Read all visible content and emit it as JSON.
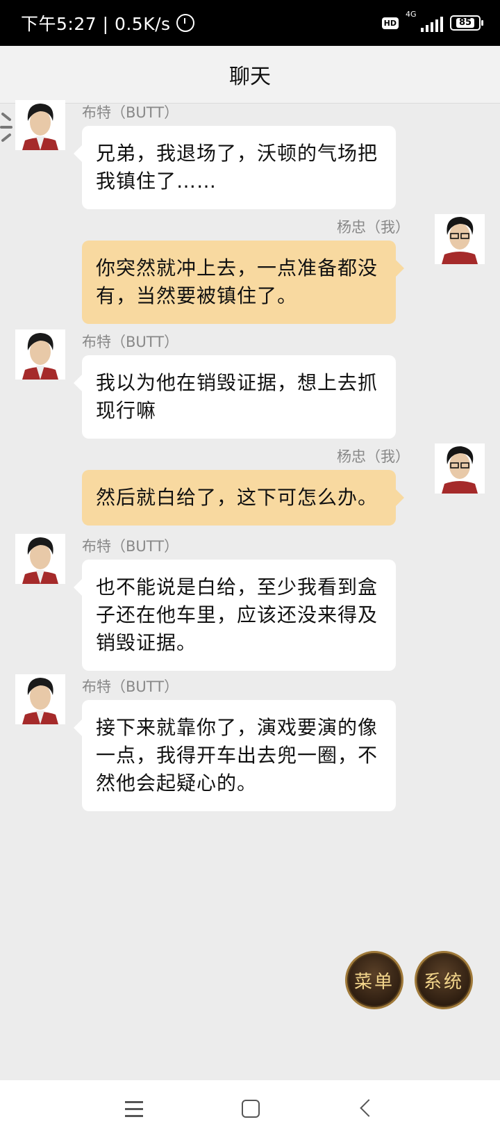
{
  "status_bar": {
    "time_speed": "下午5:27 | 0.5K/s",
    "hd": "HD",
    "network": "4G",
    "battery": "85"
  },
  "header": {
    "title": "聊天"
  },
  "messages": [
    {
      "sender": "布特（BUTT）",
      "side": "in",
      "text": "兄弟，我退场了，沃顿的气场把我镇住了……"
    },
    {
      "sender": "杨忠（我）",
      "side": "out",
      "text": "你突然就冲上去，一点准备都没有，当然要被镇住了。"
    },
    {
      "sender": "布特（BUTT）",
      "side": "in",
      "text": "我以为他在销毁证据，想上去抓现行嘛"
    },
    {
      "sender": "杨忠（我）",
      "side": "out",
      "text": "然后就白给了，这下可怎么办。"
    },
    {
      "sender": "布特（BUTT）",
      "side": "in",
      "text": "也不能说是白给，至少我看到盒子还在他车里，应该还没来得及销毁证据。"
    },
    {
      "sender": "布特（BUTT）",
      "side": "in",
      "text": "接下来就靠你了，演戏要演的像一点，我得开车出去兜一圈，不然他会起疑心的。"
    }
  ],
  "buttons": {
    "menu": "菜单",
    "system": "系统"
  },
  "colors": {
    "incoming_bubble": "#ffffff",
    "outgoing_bubble": "#f8d9a0",
    "background": "#ececec"
  },
  "icons": [
    "alarm-icon",
    "signal-icon",
    "battery-icon",
    "loading-spinner-icon",
    "nav-menu-icon",
    "nav-home-icon",
    "nav-back-icon"
  ]
}
